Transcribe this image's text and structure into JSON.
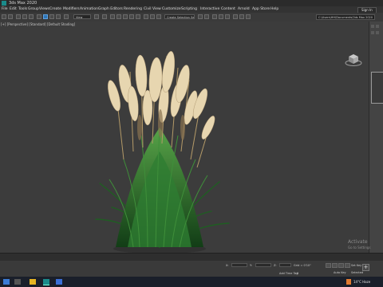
{
  "window": {
    "title": "3ds Max 2020"
  },
  "menu": [
    "File",
    "Edit",
    "Tools",
    "Group",
    "Views",
    "Create",
    "Modifiers",
    "Animation",
    "Graph Editors",
    "Rendering",
    "Civil View",
    "Customize",
    "Scripting",
    "Interactive",
    "Content",
    "Arnold",
    "App Store",
    "Help"
  ],
  "signin_label": "Sign In",
  "toolbar": {
    "view_select": "View",
    "selection_set": "Create Selection Se",
    "path": "C:\\Users\\HH\\Documents\\3ds Max 2020"
  },
  "viewport": {
    "label": "[+] [Perspective] [Standard] [Default Shading]"
  },
  "status": {
    "add_time_tag": "Add Time Tag",
    "coord_x": "X:",
    "coord_y": "Y:",
    "coord_z": "Z:",
    "grid": "Grid = 0'10\"",
    "auto_key": "Auto Key",
    "set_key": "Set Key",
    "frame": "0",
    "selected": "Selected"
  },
  "watermark": {
    "line1": "Activate",
    "line2": "Go to Settings"
  },
  "tray": {
    "weather": "14°C  Haze"
  },
  "colors": {
    "accent": "#2f76b8",
    "viewport_bg": "#3c3c3c",
    "grass": "#2e7d32",
    "plume": "#e7d6b0"
  }
}
